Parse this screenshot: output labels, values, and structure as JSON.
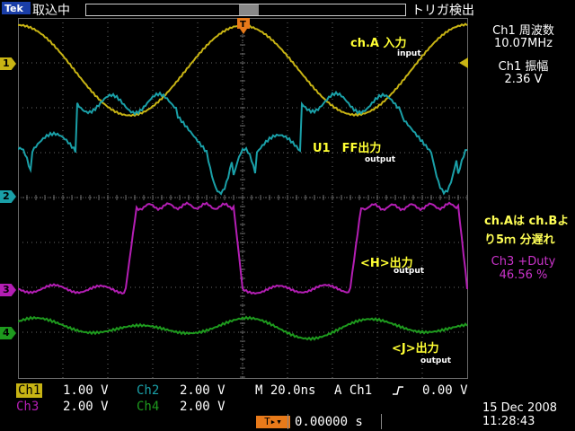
{
  "topbar": {
    "logo_text": "Tek",
    "acq_state": "取込中",
    "trigger_status": "トリガ検出",
    "trigger_marker": "T"
  },
  "colors": {
    "ch1": "#c8b414",
    "ch2": "#1aa0a8",
    "ch3": "#b41eb4",
    "ch4": "#1e9a1e",
    "grid": "#6a6a6a",
    "annotation": "#ffff33",
    "trigger": "#e87a1a"
  },
  "channel_markers": [
    "1",
    "2",
    "3",
    "4"
  ],
  "annotations": {
    "cha_label": "ch.A 入力",
    "cha_sub": "input",
    "u1_label": "U1　FF出力",
    "u1_sub": "output",
    "h_label": "<H>出力",
    "h_sub": "output",
    "j_label": "<J>出力",
    "j_sub": "output"
  },
  "measurements": {
    "ch1_freq_label": "Ch1 周波数",
    "ch1_freq_value": "10.07MHz",
    "ch1_amp_label": "Ch1 振幅",
    "ch1_amp_value": "2.36 V",
    "note_line1": "ch.Aは ch.Bよ",
    "note_line2": "り5ｍ 分遅れ",
    "duty_label": "Ch3 +Duty",
    "duty_value": "46.56 %"
  },
  "settings": {
    "ch1_tag": "Ch1",
    "ch1_scale": "1.00 V",
    "ch2_tag": "Ch2",
    "ch2_scale": "2.00 V",
    "ch3_tag": "Ch3",
    "ch3_scale": "2.00 V",
    "ch4_tag": "Ch4",
    "ch4_scale": "2.00 V",
    "timebase": "M 20.0ns",
    "trigger_src": "A  Ch1",
    "trigger_level": "0.00 V",
    "trigger_pos_value": "0.00000 s"
  },
  "timestamp": {
    "date": "15 Dec 2008",
    "time": "11:28:43"
  }
}
